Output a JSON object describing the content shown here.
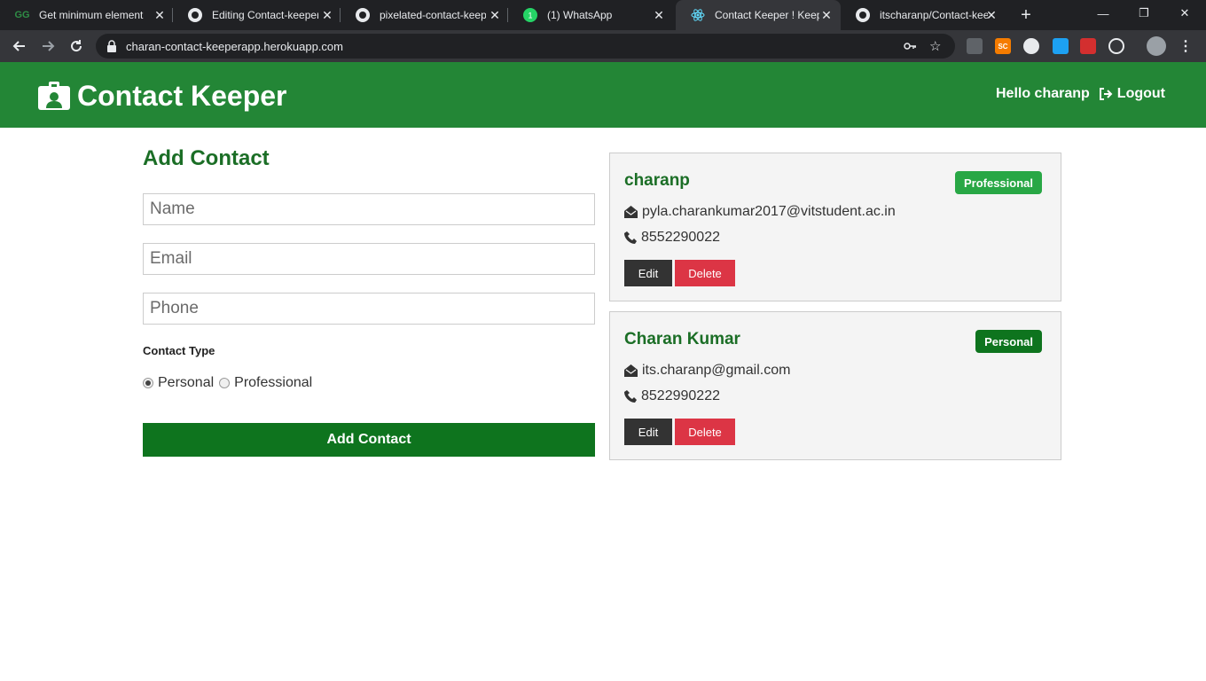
{
  "browser": {
    "tabs": [
      {
        "title": "Get minimum element",
        "icon": "gfg-icon"
      },
      {
        "title": "Editing Contact-keeper",
        "icon": "github-icon"
      },
      {
        "title": "pixelated-contact-keep",
        "icon": "github-icon"
      },
      {
        "title": "(1) WhatsApp",
        "icon": "whatsapp-icon"
      },
      {
        "title": "Contact Keeper ! Keep",
        "icon": "react-icon",
        "active": true
      },
      {
        "title": "itscharanp/Contact-kee",
        "icon": "github-icon"
      }
    ],
    "url": "charan-contact-keeperapp.herokuapp.com"
  },
  "navbar": {
    "brand": "Contact Keeper",
    "greeting": "Hello charanp",
    "logout": "Logout"
  },
  "form": {
    "title": "Add Contact",
    "name_placeholder": "Name",
    "email_placeholder": "Email",
    "phone_placeholder": "Phone",
    "contact_type_label": "Contact Type",
    "option_personal": "Personal",
    "option_professional": "Professional",
    "selected": "Personal",
    "submit_label": "Add Contact"
  },
  "contacts": [
    {
      "name": "charanp",
      "type": "Professional",
      "email": "pyla.charankumar2017@vitstudent.ac.in",
      "phone": "8552290022",
      "edit": "Edit",
      "delete": "Delete"
    },
    {
      "name": "Charan Kumar",
      "type": "Personal",
      "email": "its.charanp@gmail.com",
      "phone": "8522990222",
      "edit": "Edit",
      "delete": "Delete"
    }
  ],
  "colors": {
    "primary": "#238636",
    "dark_green": "#0e741e",
    "professional_badge": "#28a745",
    "personal_badge": "#0e741e",
    "danger": "#dc3545",
    "dark": "#333333"
  }
}
